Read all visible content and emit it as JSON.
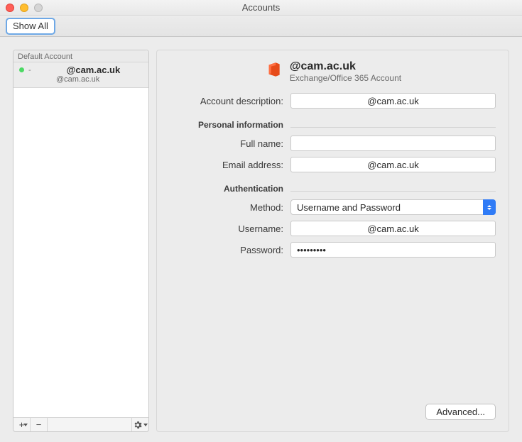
{
  "window": {
    "title": "Accounts"
  },
  "toolbar": {
    "show_all": "Show All"
  },
  "sidebar": {
    "header": "Default Account",
    "account": {
      "name": "@cam.ac.uk",
      "sub": "@cam.ac.uk"
    },
    "footer": {
      "plus": "+",
      "minus": "−"
    }
  },
  "main": {
    "title": "@cam.ac.uk",
    "type": "Exchange/Office 365 Account",
    "labels": {
      "description": "Account description:",
      "personal": "Personal information",
      "fullname": "Full name:",
      "email": "Email address:",
      "auth": "Authentication",
      "method": "Method:",
      "username": "Username:",
      "password": "Password:"
    },
    "fields": {
      "description": "@cam.ac.uk",
      "fullname": "",
      "email": "@cam.ac.uk",
      "method": "Username and Password",
      "username": "@cam.ac.uk",
      "password": "•••••••••"
    },
    "advanced": "Advanced..."
  }
}
